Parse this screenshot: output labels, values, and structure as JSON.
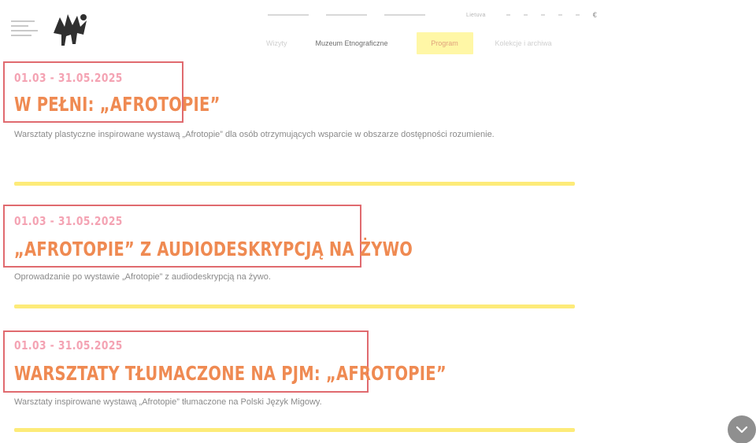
{
  "header": {
    "lang_label": "Lietuva",
    "currency_icon": "euro-icon",
    "currency_symbol": "€",
    "nav": [
      {
        "label": "Wizyty",
        "style": "faded"
      },
      {
        "label": "Muzeum Etnograficzne",
        "style": "dark"
      },
      {
        "label": "Program",
        "style": "active"
      },
      {
        "label": "Kolekcje i archiwa",
        "style": "faded"
      }
    ],
    "colors": {
      "nav_active_bg": "#fff7a6",
      "nav_active_text": "#e0a37d"
    }
  },
  "events": [
    {
      "date": "01.03 - 31.05.2025",
      "title": "W PEŁNI: „AFROTOPIE”",
      "description": "Warsztaty plastyczne inspirowane wystawą „Afrotopie” dla osób otrzymujących wsparcie w obszarze dostępności rozumienie."
    },
    {
      "date": "01.03 - 31.05.2025",
      "title": "„AFROTOPIE” Z AUDIODESKRYPCJĄ NA ŻYWO",
      "description": "Oprowadzanie po wystawie „Afrotopie” z audiodeskrypcją na żywo."
    },
    {
      "date": "01.03 - 31.05.2025",
      "title": "WARSZTATY TŁUMACZONE NA PJM: „AFROTOPIE”",
      "description": "Warsztaty inspirowane wystawą „Afrotopie” tłumaczone na Polski Język Migowy."
    }
  ],
  "colors": {
    "date": "#f4a3b3",
    "title": "#ef8a52",
    "highlight_border": "#e06a6f",
    "separator": "#fde96a"
  },
  "scroll_icon": "chevron-down-icon"
}
